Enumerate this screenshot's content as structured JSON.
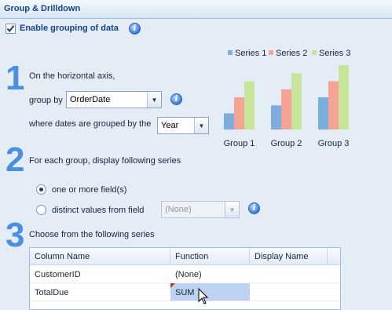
{
  "header": {
    "title": "Group & Drilldown"
  },
  "enable_grouping": {
    "label": "Enable grouping of data",
    "checked": true
  },
  "step1": {
    "number": "1",
    "text": "On the horizontal axis,",
    "group_by_label": "group by",
    "group_by_value": "OrderDate",
    "dates_label": "where dates are grouped by the",
    "dates_value": "Year"
  },
  "step2": {
    "number": "2",
    "text": "For each group, display following series",
    "option1": {
      "label": "one or more field(s)",
      "selected": true
    },
    "option2": {
      "label": "distinct values from field",
      "selected": false
    },
    "field_value": "(None)"
  },
  "step3": {
    "number": "3",
    "text": "Choose from the following series"
  },
  "grid": {
    "columns": [
      "Column Name",
      "Function",
      "Display Name"
    ],
    "rows": [
      [
        "CustomerID",
        "(None)",
        ""
      ],
      [
        "TotalDue",
        "SUM",
        ""
      ]
    ]
  },
  "chart_data": {
    "type": "bar",
    "categories": [
      "Group 1",
      "Group 2",
      "Group 3"
    ],
    "series": [
      {
        "name": "Series 1",
        "values": [
          1,
          1.5,
          2
        ]
      },
      {
        "name": "Series 2",
        "values": [
          2,
          2.5,
          3
        ]
      },
      {
        "name": "Series 3",
        "values": [
          3,
          3.5,
          4
        ]
      }
    ],
    "colors": [
      "#7baede",
      "#f4a394",
      "#c6e49a"
    ],
    "ylim": [
      0,
      4
    ],
    "legend": "top",
    "grid": false
  }
}
